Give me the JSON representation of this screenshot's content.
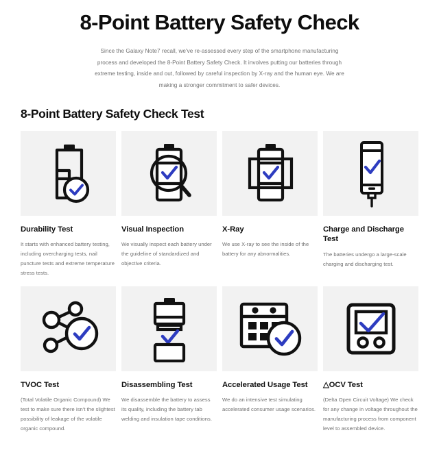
{
  "hero": {
    "title": "8-Point Battery Safety Check",
    "subtitle": "Since the Galaxy Note7 recall, we've re-assessed every step of the smartphone manufacturing process and developed the 8-Point Battery Safety Check.  It involves putting our batteries through extreme testing, inside and out, followed by careful inspection by X-ray and the human eye. We are making a stronger commitment to safer devices."
  },
  "section": {
    "heading": "8-Point Battery Safety Check Test"
  },
  "colors": {
    "check_blue": "#2d3cc0",
    "icon_black": "#111111",
    "thumb_bg": "#f2f2f2",
    "body_text": "#6f6f6f",
    "heading_text": "#111111",
    "page_bg": "#ffffff"
  },
  "cards": [
    {
      "icon": "battery-check-icon",
      "title": "Durability Test",
      "description": "It starts with enhanced battery testing, including overcharging tests, nail puncture tests and extreme temperature stress tests."
    },
    {
      "icon": "battery-magnifier-icon",
      "title": "Visual Inspection",
      "description": "We visually inspect each battery under the guideline of standardized and objective criteria."
    },
    {
      "icon": "battery-xray-icon",
      "title": "X-Ray",
      "description": "We use X-ray to see the inside of the battery for any abnormalities."
    },
    {
      "icon": "phone-charging-icon",
      "title": "Charge and Discharge Test",
      "description": "The batteries undergo a large-scale charging and discharging test."
    },
    {
      "icon": "molecule-check-icon",
      "title": "TVOC Test",
      "description": "(Total Volatile Organic Compound) We test to make sure there isn't the slightest possibility of leakage of the volatile organic compound."
    },
    {
      "icon": "battery-split-icon",
      "title": "Disassembling Test",
      "description": "We disassemble the battery to assess its quality, including the battery tab welding and insulation tape conditions."
    },
    {
      "icon": "calendar-check-icon",
      "title": "Accelerated Usage Test",
      "description": "We do an intensive test simulating accelerated consumer usage scenarios."
    },
    {
      "icon": "voltmeter-check-icon",
      "title": "△OCV Test",
      "description": "(Delta Open Circuit Voltage) We check for any change in voltage throughout the manufacturing process from component level to assembled device."
    }
  ]
}
